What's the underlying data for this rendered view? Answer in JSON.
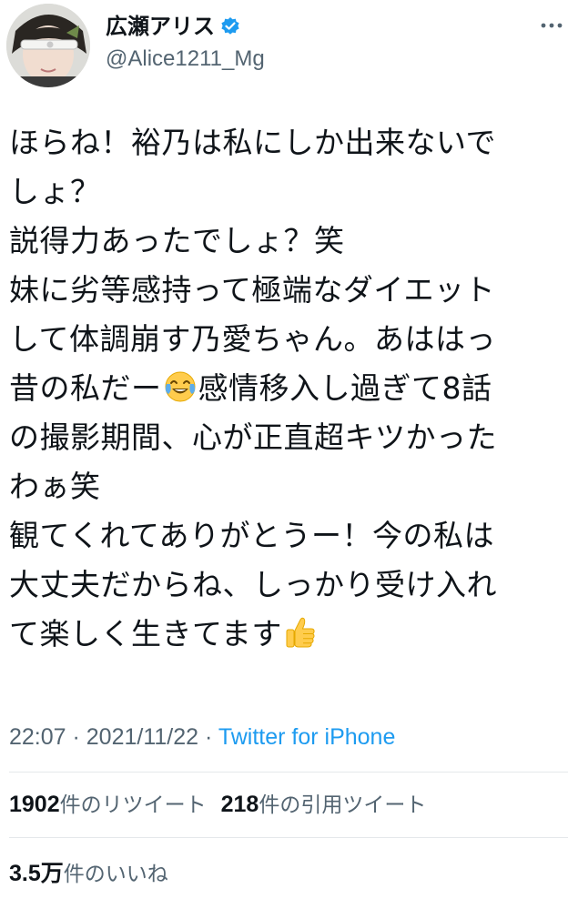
{
  "user": {
    "display_name": "広瀬アリス",
    "handle": "@Alice1211_Mg",
    "verified_icon": "verified-badge-icon",
    "accent": "#1d9bf0"
  },
  "tweet": {
    "lines": [
      "ほらね！裕乃は私にしか出来ないで",
      "しょ？",
      "説得力あったでしょ？笑",
      "妹に劣等感持って極端なダイエット",
      "して体調崩す乃愛ちゃん。あははっ",
      {
        "before": "昔の私だー",
        "emoji": "face-with-tears-of-joy",
        "after": "感情移入し過ぎて8話"
      },
      "の撮影期間、心が正直超キツかった",
      "わぁ笑",
      "観てくれてありがとうー！今の私は",
      "大丈夫だからね、しっかり受け入れ",
      {
        "before": "て楽しく生きてます",
        "emoji": "thumbs-up",
        "after": ""
      }
    ]
  },
  "meta": {
    "time": "22:07",
    "sep1": " · ",
    "date": "2021/11/22",
    "sep2": " · ",
    "source": "Twitter for iPhone"
  },
  "stats": {
    "retweets_num": "1902",
    "retweets_label": "件のリツイート",
    "quotes_num": "218",
    "quotes_label": "件の引用ツイート",
    "likes_num": "3.5万",
    "likes_label": "件のいいね"
  },
  "colors": {
    "text": "#0f1419",
    "secondary": "#536471",
    "link": "#1d9bf0",
    "divider": "#e5e8eb"
  }
}
